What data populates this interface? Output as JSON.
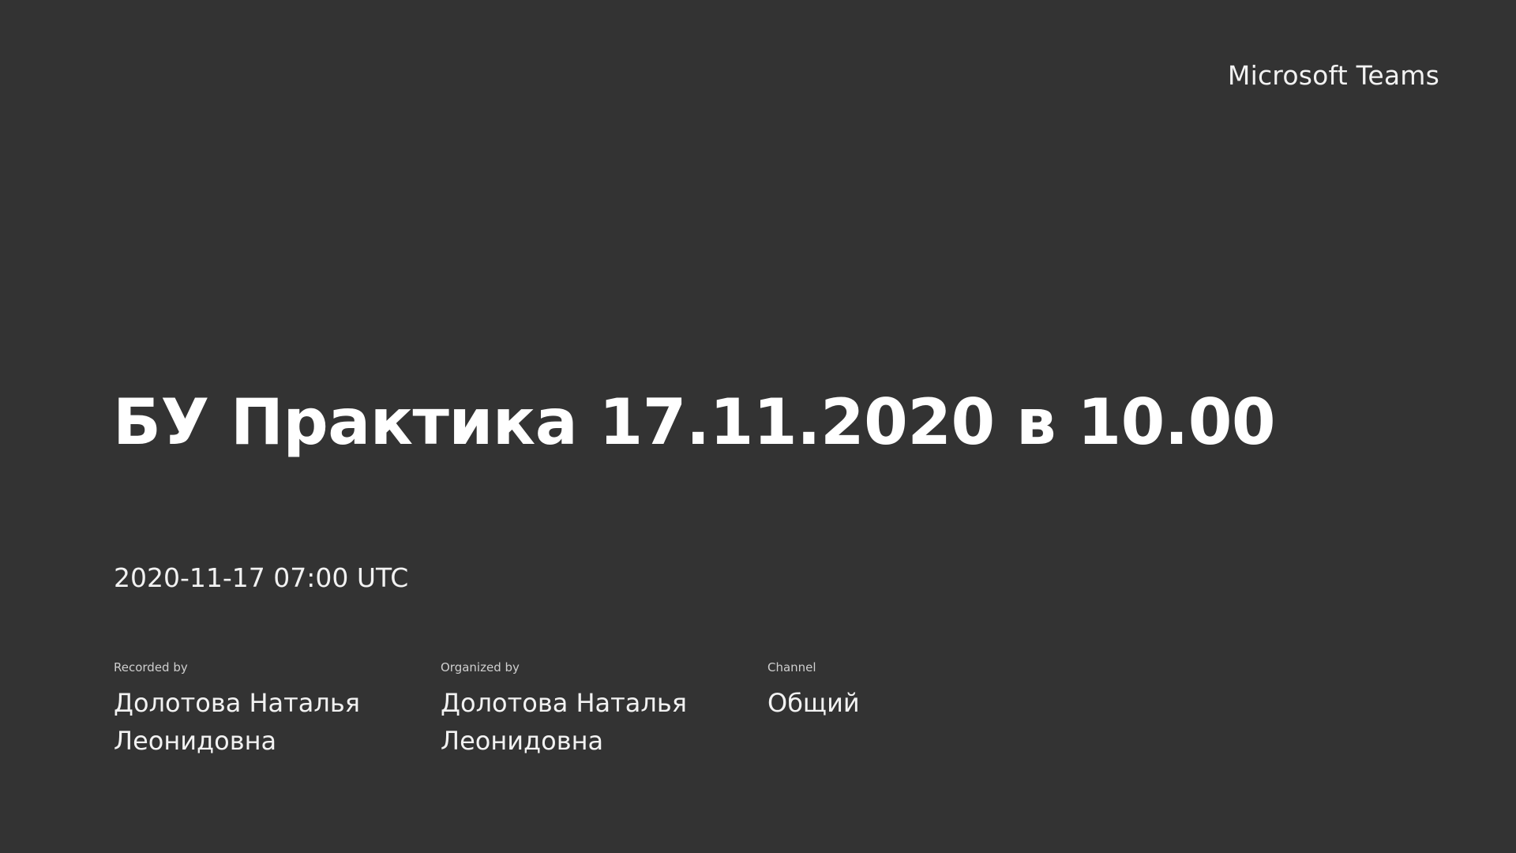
{
  "brand": "Microsoft Teams",
  "meeting": {
    "title": "БУ Практика 17.11.2020 в 10.00",
    "datetime": "2020-11-17 07:00 UTC"
  },
  "details": {
    "recorded_by_label": "Recorded by",
    "recorded_by_value": "Долотова Наталья Леонидовна",
    "organized_by_label": "Organized by",
    "organized_by_value": "Долотова Наталья Леонидовна",
    "channel_label": "Channel",
    "channel_value": "Общий"
  },
  "colors": {
    "background": "#333333",
    "text": "#ffffff"
  }
}
